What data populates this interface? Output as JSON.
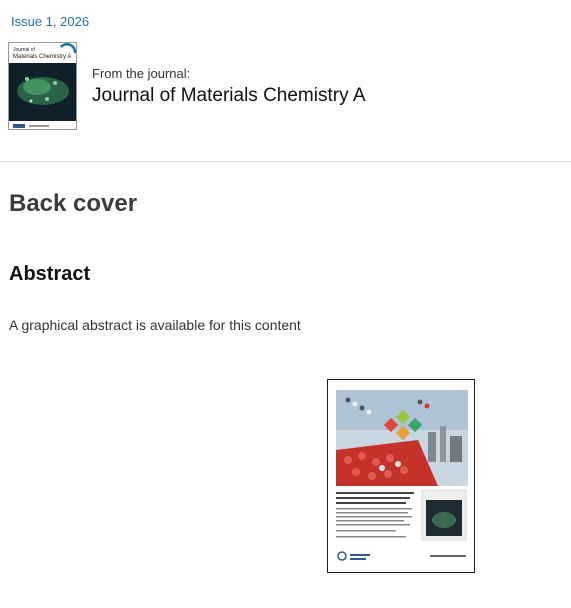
{
  "issue": {
    "label": "Issue 1, 2026"
  },
  "journal": {
    "from_label": "From the journal:",
    "name": "Journal of Materials Chemistry A",
    "cover_title_line1": "Journal of",
    "cover_title_line2": "Materials Chemistry A"
  },
  "article": {
    "type": "Back cover",
    "abstract_heading": "Abstract",
    "abstract_text": "A graphical abstract is available for this content"
  },
  "colors": {
    "link": "#1a73a8",
    "cover_dark": "#10202a",
    "cover_green": "#2f6f4a",
    "ga_red": "#c4322b"
  }
}
